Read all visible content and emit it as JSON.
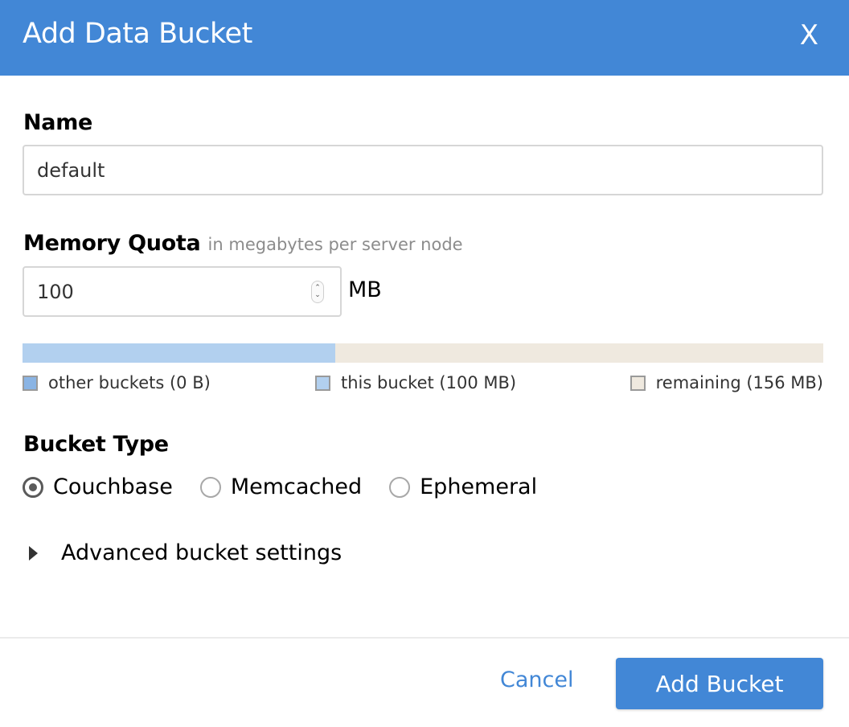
{
  "dialog": {
    "title": "Add Data Bucket",
    "close_label": "X"
  },
  "name_field": {
    "label": "Name",
    "value": "default"
  },
  "memory_quota": {
    "label": "Memory Quota",
    "hint": "in megabytes per server node",
    "value": "100",
    "unit": "MB"
  },
  "quota_bar": {
    "total_mb": 256,
    "other_buckets_mb": 0,
    "this_bucket_mb": 100,
    "remaining_mb": 156,
    "colors": {
      "other": "#8ab4e4",
      "this": "#b2d0ef",
      "remaining": "#efe9df"
    },
    "legend": {
      "other": "other buckets (0 B)",
      "this": "this bucket (100 MB)",
      "remaining": "remaining (156 MB)"
    }
  },
  "bucket_type": {
    "label": "Bucket Type",
    "options": [
      {
        "label": "Couchbase",
        "selected": true
      },
      {
        "label": "Memcached",
        "selected": false
      },
      {
        "label": "Ephemeral",
        "selected": false
      }
    ]
  },
  "advanced": {
    "label": "Advanced bucket settings",
    "expanded": false
  },
  "footer": {
    "cancel_label": "Cancel",
    "submit_label": "Add Bucket"
  },
  "colors": {
    "accent": "#4287d6"
  }
}
